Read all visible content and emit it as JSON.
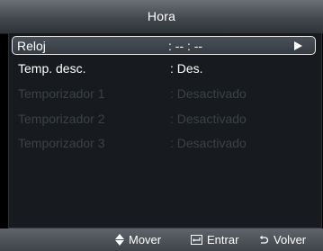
{
  "header": {
    "title": "Hora"
  },
  "menu": {
    "items": [
      {
        "label": "Reloj",
        "value": ": -- : --",
        "enabled": true,
        "selected": true
      },
      {
        "label": "Temp. desc.",
        "value": ": Des.",
        "enabled": true,
        "selected": false
      },
      {
        "label": "Temporizador 1",
        "value": ": Desactivado",
        "enabled": false,
        "selected": false
      },
      {
        "label": "Temporizador 2",
        "value": ": Desactivado",
        "enabled": false,
        "selected": false
      },
      {
        "label": "Temporizador 3",
        "value": ": Desactivado",
        "enabled": false,
        "selected": false
      }
    ]
  },
  "footer": {
    "move_label": "Mover",
    "enter_label": "Entrar",
    "back_label": "Volver"
  },
  "icons": {
    "submenu": "arrow-right-icon",
    "move": "up-down-arrows-icon",
    "enter": "enter-icon",
    "back": "return-icon"
  },
  "colors": {
    "selection_border": "#e8e8e8",
    "disabled_text": "#3c4146",
    "text": "#ffffff"
  }
}
